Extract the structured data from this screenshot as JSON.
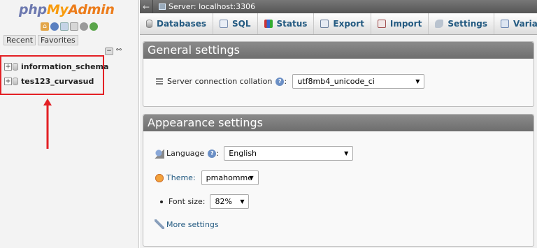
{
  "sidebar": {
    "logo": {
      "php": "php",
      "my": "My",
      "admin": "Admin"
    },
    "quick_icons": [
      "home-icon",
      "logout-icon",
      "docs-icon",
      "sql-docs-icon",
      "settings-icon",
      "reload-icon"
    ],
    "tabs": [
      "Recent",
      "Favorites"
    ],
    "databases": [
      {
        "label": "information_schema",
        "expand": "+"
      },
      {
        "label": "tes123_curvasud",
        "expand": "+"
      }
    ]
  },
  "serverbar": {
    "back": "←",
    "label": "Server: localhost:3306"
  },
  "topmenu": {
    "tabs": [
      {
        "label": "Databases",
        "icon": "databases-icon"
      },
      {
        "label": "SQL",
        "icon": "sql-icon"
      },
      {
        "label": "Status",
        "icon": "status-icon"
      },
      {
        "label": "Export",
        "icon": "export-icon"
      },
      {
        "label": "Import",
        "icon": "import-icon"
      },
      {
        "label": "Settings",
        "icon": "wrench-icon"
      },
      {
        "label": "Variables",
        "icon": "variables-icon"
      }
    ]
  },
  "general": {
    "title": "General settings",
    "collation_label": "Server connection collation",
    "collation_value": "utf8mb4_unicode_ci"
  },
  "appearance": {
    "title": "Appearance settings",
    "language_label": "Language",
    "language_value": "English",
    "theme_label": "Theme:",
    "theme_value": "pmahomme",
    "fontsize_label": "Font size:",
    "fontsize_value": "82%",
    "more_settings": "More settings"
  },
  "colors": {
    "annotation_red": "#e32025",
    "link_blue": "#235a81",
    "panel_header": "#777777"
  }
}
